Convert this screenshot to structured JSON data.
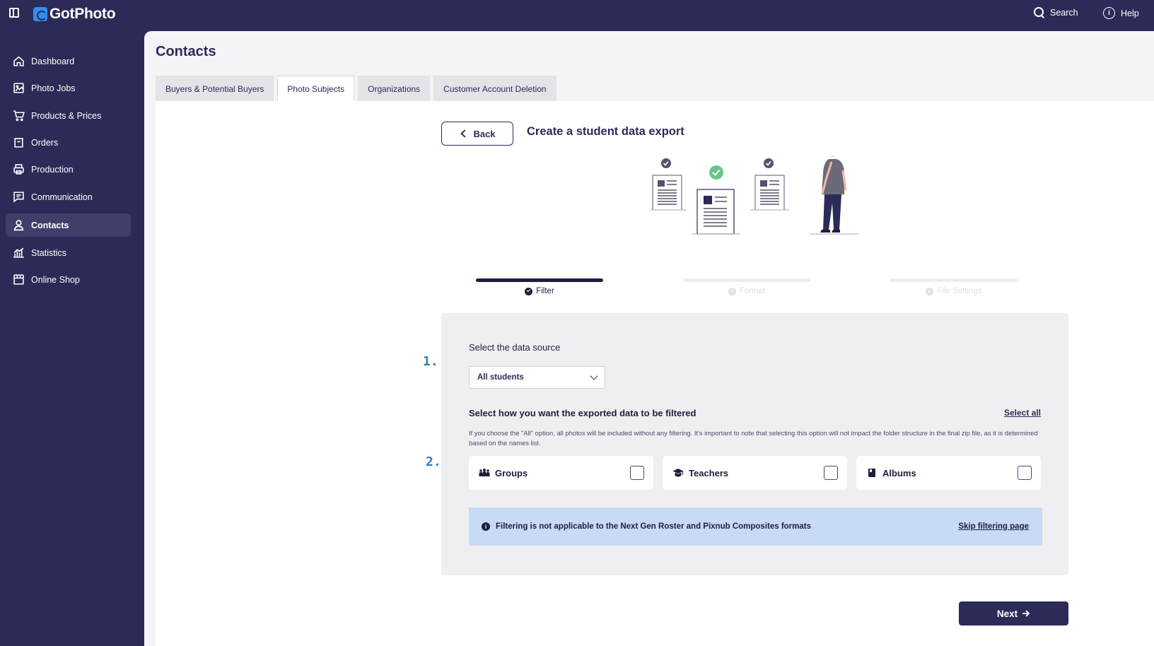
{
  "app": {
    "brand": "GotPhoto"
  },
  "topbar": {
    "search_label": "Search",
    "help_label": "Help"
  },
  "sidebar": {
    "items": [
      {
        "label": "Dashboard",
        "icon": "home-icon"
      },
      {
        "label": "Photo Jobs",
        "icon": "image-icon"
      },
      {
        "label": "Products & Prices",
        "icon": "cart-icon"
      },
      {
        "label": "Orders",
        "icon": "basket-icon"
      },
      {
        "label": "Production",
        "icon": "printer-icon"
      },
      {
        "label": "Communication",
        "icon": "message-icon"
      },
      {
        "label": "Contacts",
        "icon": "user-icon",
        "active": true
      },
      {
        "label": "Statistics",
        "icon": "chart-icon"
      },
      {
        "label": "Online Shop",
        "icon": "store-icon"
      }
    ]
  },
  "page": {
    "title": "Contacts"
  },
  "tabs": [
    {
      "label": "Buyers & Potential Buyers"
    },
    {
      "label": "Photo Subjects",
      "active": true
    },
    {
      "label": "Organizations"
    },
    {
      "label": "Customer Account Deletion"
    }
  ],
  "export": {
    "back_label": "Back",
    "title": "Create a student data export"
  },
  "steps": [
    {
      "label": "Filter",
      "active": true
    },
    {
      "label": "Format",
      "active": false
    },
    {
      "label": "File Settings",
      "active": false
    }
  ],
  "annotations": {
    "one": "1.",
    "two": "2."
  },
  "panel": {
    "data_source_label": "Select the data source",
    "data_source_value": "All students",
    "filter_label": "Select how you want the exported data to be filtered",
    "select_all_label": "Select all",
    "helper_text": "If you choose the \"All\" option, all photos will be included without any filtering. It's important to note that selecting this option will not impact the folder structure in the final zip file, as it is determined based on the names list.",
    "options": [
      {
        "label": "Groups",
        "icon": "groups-icon",
        "checked": false
      },
      {
        "label": "Teachers",
        "icon": "graduation-cap-icon",
        "checked": false
      },
      {
        "label": "Albums",
        "icon": "album-icon",
        "checked": false
      }
    ],
    "banner_text": "Filtering is not applicable to the Next Gen Roster and Pixnub Composites formats",
    "skip_label": "Skip filtering page"
  },
  "next_label": "Next",
  "colors": {
    "navy": "#2c2b57",
    "accent_green": "#6cc48d",
    "info_banner": "#c7daf6",
    "annotation_blue": "#2d7fc1"
  }
}
